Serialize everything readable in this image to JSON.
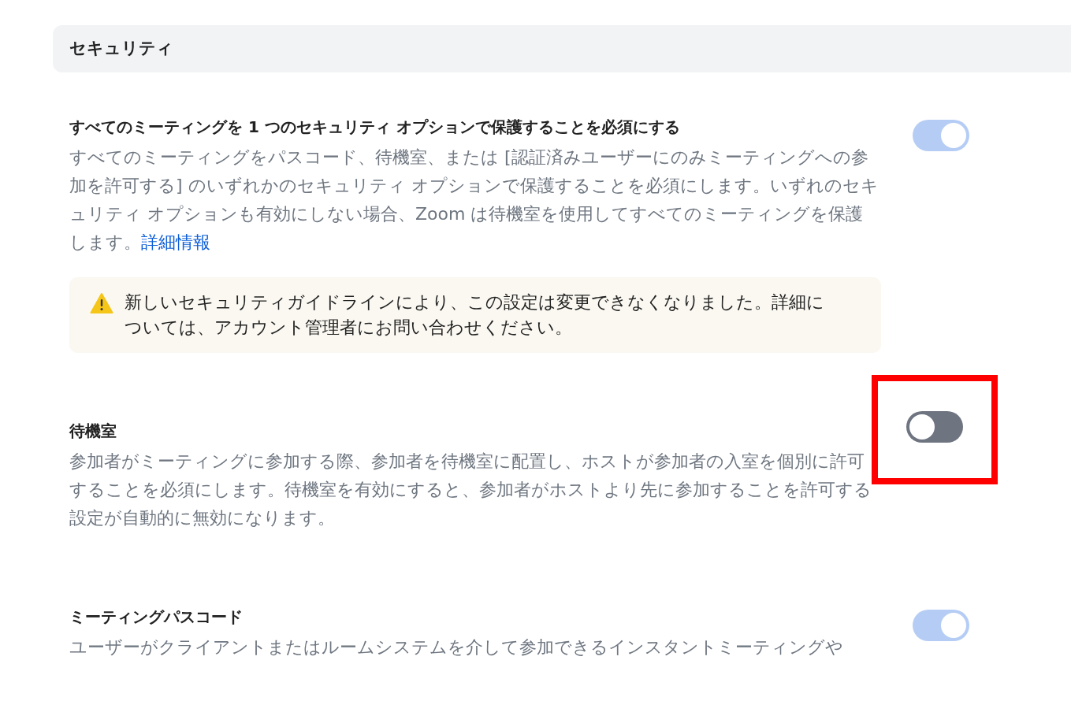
{
  "section": {
    "title": "セキュリティ"
  },
  "settings": [
    {
      "title": "すべてのミーティングを 1 つのセキュリティ オプションで保護することを必須にする",
      "description": "すべてのミーティングをパスコード、待機室、または [認証済みユーザーにのみミーティングへの参加を許可する] のいずれかのセキュリティ オプションで保護することを必須にします。いずれのセキュリティ オプションも有効にしない場合、Zoom は待機室を使用してすべてのミーティングを保護します。",
      "link": "詳細情報",
      "on": true,
      "disabled": true,
      "highlighted": false,
      "notice": "新しいセキュリティガイドラインにより、この設定は変更できなくなりました。詳細については、アカウント管理者にお問い合わせください。"
    },
    {
      "title": "待機室",
      "description": "参加者がミーティングに参加する際、参加者を待機室に配置し、ホストが参加者の入室を個別に許可することを必須にします。待機室を有効にすると、参加者がホストより先に参加することを許可する設定が自動的に無効になります。",
      "on": false,
      "disabled": false,
      "highlighted": true
    },
    {
      "title": "ミーティングパスコード",
      "description": "ユーザーがクライアントまたはルームシステムを介して参加できるインスタントミーティングや",
      "on": true,
      "disabled": true,
      "highlighted": false
    }
  ]
}
